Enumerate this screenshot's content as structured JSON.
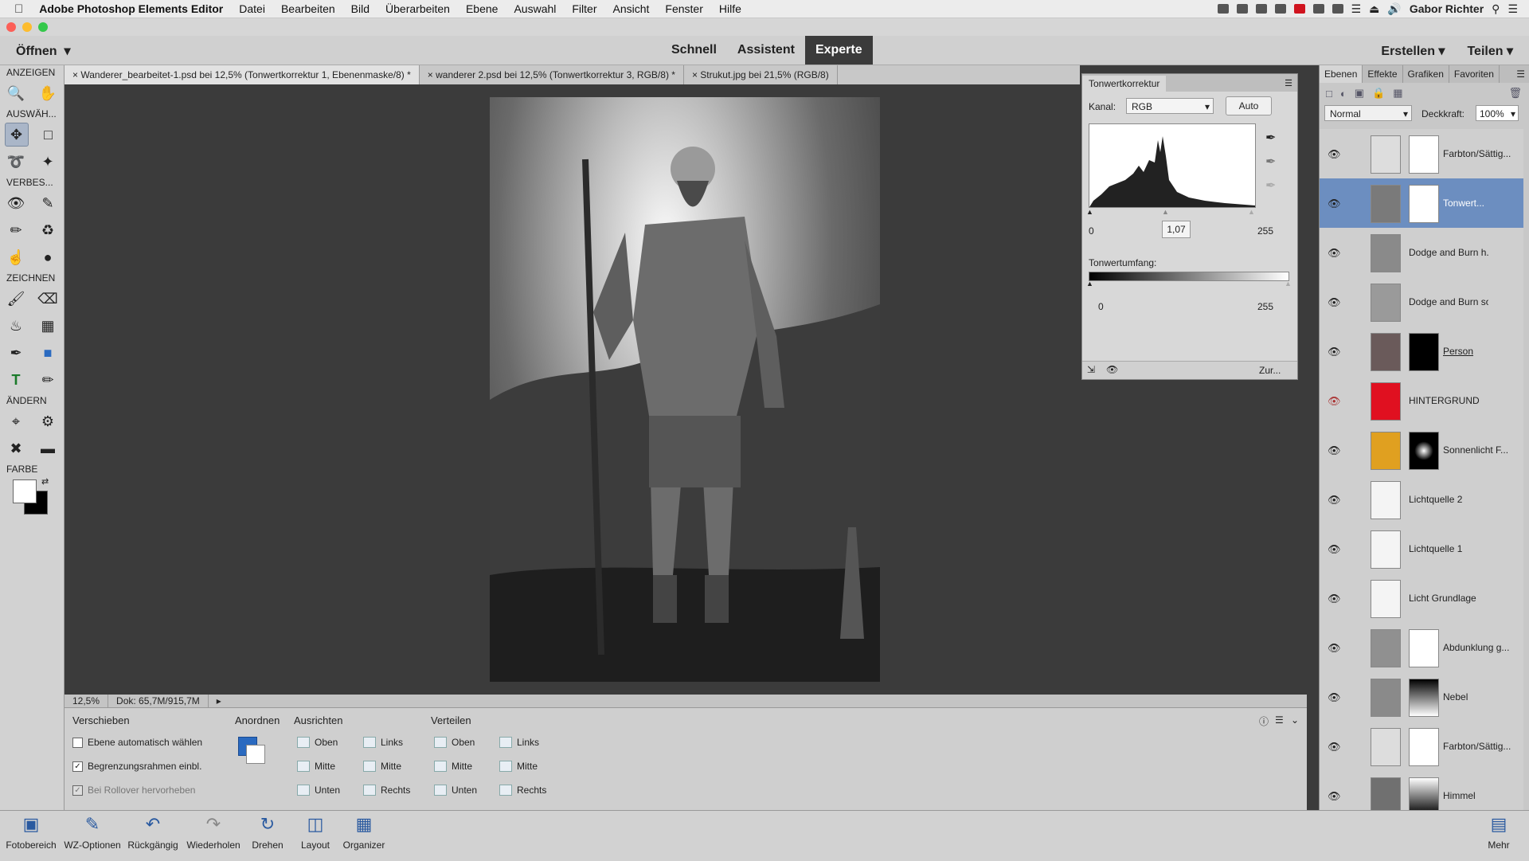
{
  "menubar": {
    "app_name": "Adobe Photoshop Elements Editor",
    "items": [
      "Datei",
      "Bearbeiten",
      "Bild",
      "Überarbeiten",
      "Ebene",
      "Auswahl",
      "Filter",
      "Ansicht",
      "Fenster",
      "Hilfe"
    ],
    "user": "Gabor Richter"
  },
  "modebar": {
    "open_label": "Öffnen",
    "tabs": [
      "Schnell",
      "Assistent",
      "Experte"
    ],
    "active_tab": "Experte",
    "create_label": "Erstellen",
    "share_label": "Teilen"
  },
  "toolbox": {
    "sections": [
      "ANZEIGEN",
      "AUSWÄH...",
      "VERBES...",
      "ZEICHNEN",
      "ÄNDERN",
      "FARBE"
    ]
  },
  "doc_tabs": [
    "Wanderer_bearbeitet-1.psd bei 12,5% (Tonwertkorrektur 1, Ebenenmaske/8) *",
    "wanderer 2.psd bei 12,5% (Tonwertkorrektur 3, RGB/8) *",
    "Strukut.jpg bei 21,5% (RGB/8)"
  ],
  "status": {
    "zoom": "12,5%",
    "doc": "Dok: 65,7M/915,7M"
  },
  "options": {
    "section_move": "Verschieben",
    "auto_select": "Ebene automatisch wählen",
    "bounding_box": "Begrenzungsrahmen einbl.",
    "rollover": "Bei Rollover hervorheben",
    "section_arrange": "Anordnen",
    "section_align": "Ausrichten",
    "section_distribute": "Verteilen",
    "align_items": [
      "Oben",
      "Mitte",
      "Unten",
      "Links",
      "Mitte",
      "Rechts"
    ],
    "distribute_items": [
      "Oben",
      "Mitte",
      "Unten",
      "Links",
      "Mitte",
      "Rechts"
    ]
  },
  "bottombar": {
    "items": [
      "Fotobereich",
      "WZ-Optionen",
      "Rückgängig",
      "Wiederholen",
      "Drehen",
      "Layout",
      "Organizer"
    ],
    "more": "Mehr"
  },
  "tonwert": {
    "tab": "Tonwertkorrektur",
    "channel_label": "Kanal:",
    "channel_value": "RGB",
    "auto_label": "Auto",
    "input_black": "0",
    "input_gamma": "1,07",
    "input_white": "255",
    "output_label": "Tonwertumfang:",
    "output_black": "0",
    "output_white": "255",
    "reset_label": "Zur..."
  },
  "layers": {
    "tabs": [
      "Ebenen",
      "Effekte",
      "Grafiken",
      "Favoriten"
    ],
    "blend_mode": "Normal",
    "opacity_label": "Deckkraft:",
    "opacity_value": "100%",
    "rows": [
      {
        "name": "Farbton/Sättig...",
        "thumb": "#f0f0f0"
      },
      {
        "name": "Tonwert...",
        "thumb": "#7a7a7a"
      },
      {
        "name": "Dodge and Burn h...",
        "thumb": "#8a8a8a"
      },
      {
        "name": "Dodge and Burn soft",
        "thumb": "#9a9a9a"
      },
      {
        "name": "Person",
        "thumb": "#6a5a5a"
      },
      {
        "name": "HINTERGRUND",
        "thumb": "#e01020"
      },
      {
        "name": "Sonnenlicht F...",
        "thumb": "#e0a020"
      },
      {
        "name": "Lichtquelle 2",
        "thumb": "#f4f4f4"
      },
      {
        "name": "Lichtquelle 1",
        "thumb": "#f4f4f4"
      },
      {
        "name": "Licht Grundlage",
        "thumb": "#f4f4f4"
      },
      {
        "name": "Abdunklung g...",
        "thumb": "#909090"
      },
      {
        "name": "Nebel",
        "thumb": "#8a8a8a"
      },
      {
        "name": "Farbton/Sättig...",
        "thumb": "#f0f0f0"
      },
      {
        "name": "Himmel",
        "thumb": "#707070"
      }
    ]
  }
}
